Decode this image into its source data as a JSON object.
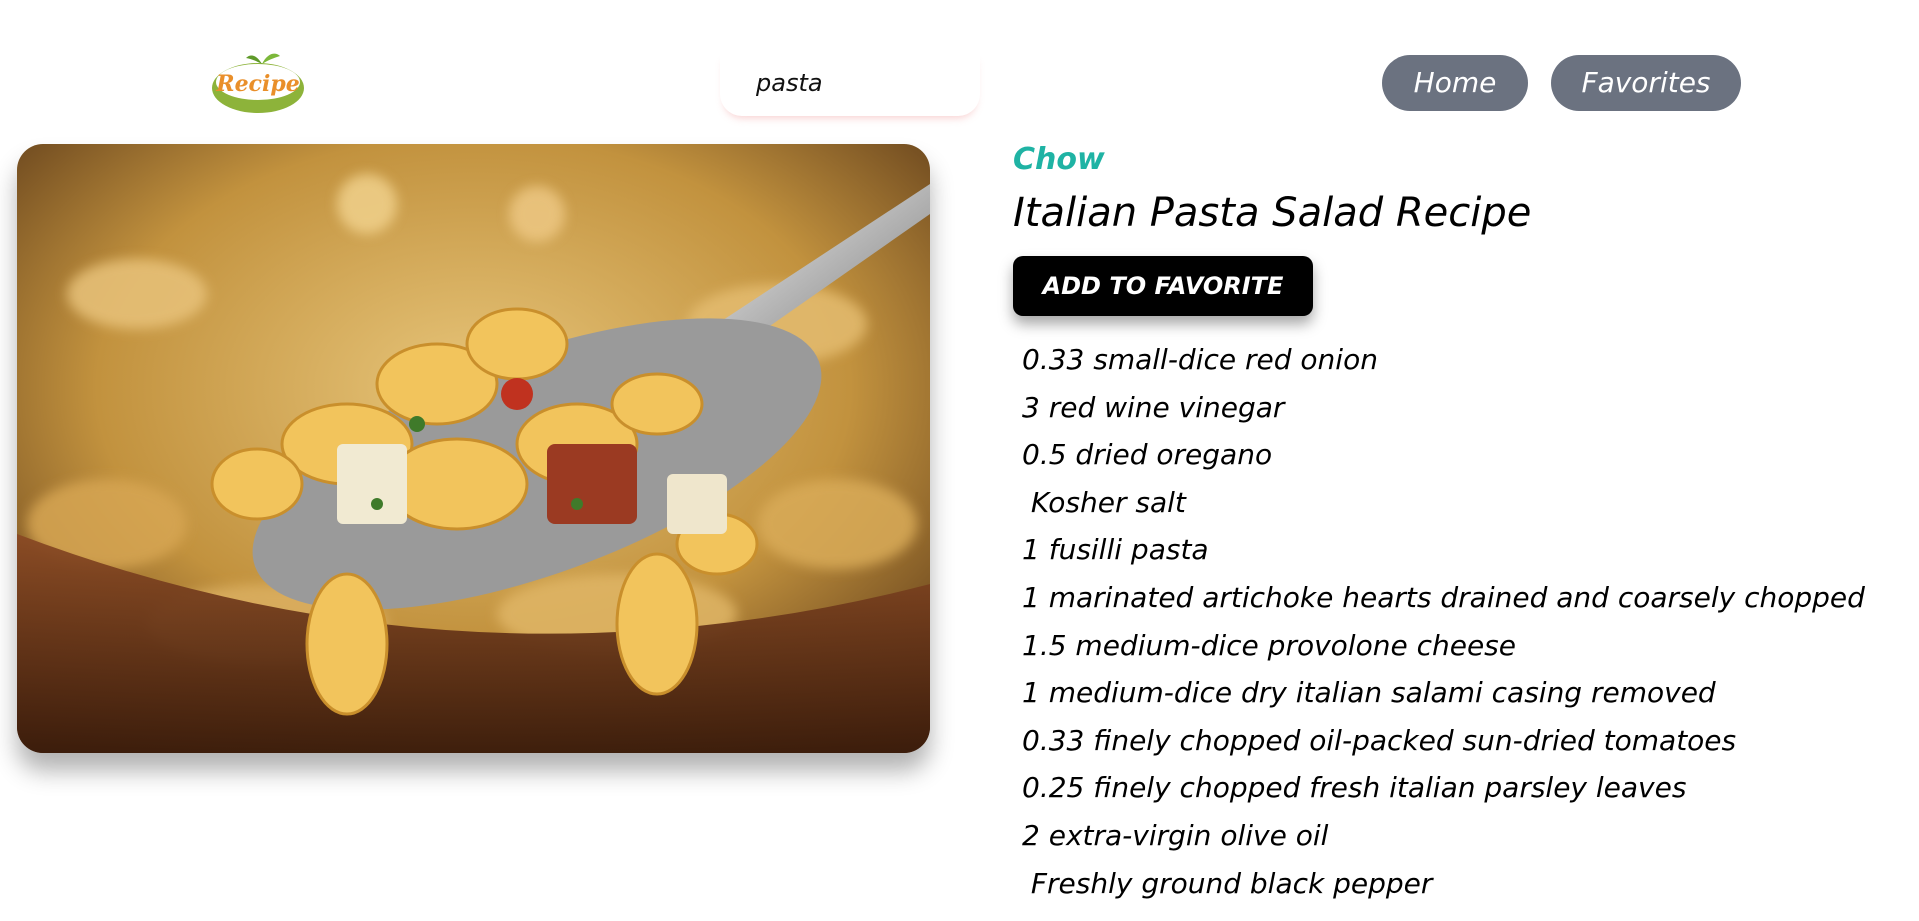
{
  "header": {
    "logo_text": "Recipe",
    "search": {
      "value": "pasta",
      "placeholder": ""
    },
    "nav": {
      "home_label": "Home",
      "favorites_label": "Favorites"
    }
  },
  "recipe": {
    "source": "Chow",
    "title": "Italian Pasta Salad Recipe",
    "add_favorite_label": "ADD TO FAVORITE",
    "ingredients": [
      "0.33 small-dice red onion",
      "3 red wine vinegar",
      "0.5 dried oregano",
      " Kosher salt",
      "1 fusilli pasta",
      "1 marinated artichoke hearts drained and coarsely chopped",
      "1.5 medium-dice provolone cheese",
      "1 medium-dice dry italian salami casing removed",
      "0.33 finely chopped oil-packed sun-dried tomatoes",
      "0.25 finely chopped fresh italian parsley leaves",
      "2 extra-virgin olive oil",
      " Freshly ground black pepper"
    ]
  },
  "colors": {
    "accent": "#1fb3a4",
    "nav_button": "#6b7280",
    "primary_button": "#000000"
  }
}
